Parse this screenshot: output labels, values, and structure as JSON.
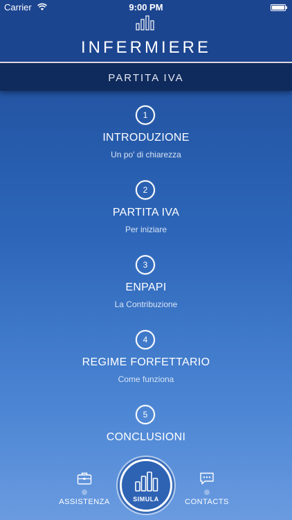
{
  "status_bar": {
    "carrier": "Carrier",
    "time": "9:00 PM",
    "battery_percent": 100
  },
  "header": {
    "logo_icon": "bar-chart-icon",
    "title": "INFERMIERE"
  },
  "section": {
    "title": "PARTITA IVA"
  },
  "chapters": [
    {
      "number": "1",
      "title": "INTRODUZIONE",
      "subtitle": "Un po' di chiarezza"
    },
    {
      "number": "2",
      "title": "PARTITA IVA",
      "subtitle": "Per iniziare"
    },
    {
      "number": "3",
      "title": "ENPAPI",
      "subtitle": "La Contribuzione"
    },
    {
      "number": "4",
      "title": "REGIME FORFETTARIO",
      "subtitle": "Come funziona"
    },
    {
      "number": "5",
      "title": "CONCLUSIONI",
      "subtitle": ""
    }
  ],
  "tab_bar": {
    "assistenza": {
      "label": "ASSISTENZA",
      "icon": "briefcase-icon"
    },
    "simula": {
      "label": "SIMULA",
      "icon": "bar-chart-icon"
    },
    "contacts": {
      "label": "CONTACTS",
      "icon": "chat-bubble-icon"
    }
  },
  "colors": {
    "header_bg": "#1c4590",
    "section_bar_bg": "#0f2a5c",
    "gradient_top": "#1c4a95",
    "gradient_bottom": "#6a9be0",
    "text": "#ffffff"
  }
}
